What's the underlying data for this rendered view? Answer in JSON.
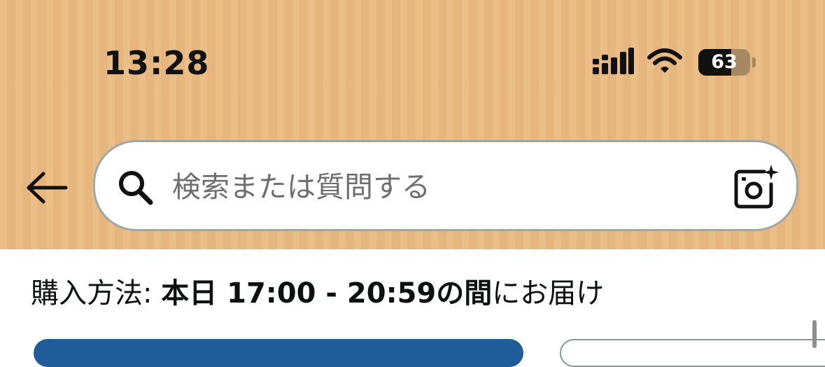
{
  "status_bar": {
    "time": "13:28",
    "battery_level": "63",
    "battery_fraction": 0.63,
    "icons": [
      "cellular-signal-icon",
      "wifi-icon",
      "battery-icon"
    ]
  },
  "header": {
    "back_icon": "back-arrow-icon",
    "background_color": "#EAB980"
  },
  "search": {
    "placeholder": "検索または質問する",
    "search_icon": "search-icon",
    "camera_icon": "camera-sparkle-icon",
    "border_color": "#9DA8A6"
  },
  "delivery": {
    "label": "購入方法: ",
    "day": "本日",
    "time_range": "17:00 - 20:59",
    "between": "の間",
    "suffix": "にお届け"
  },
  "colors": {
    "primary_button": "#1F5C99",
    "text": "#0F1111"
  }
}
